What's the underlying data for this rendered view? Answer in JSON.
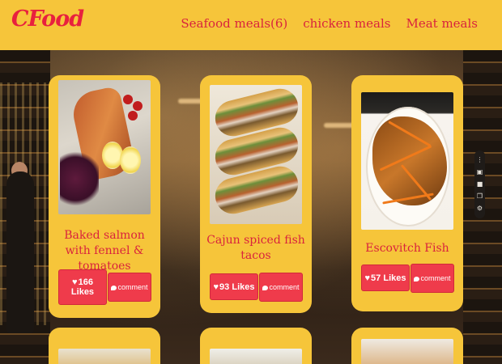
{
  "header": {
    "logo": "CFood",
    "nav": [
      {
        "label": "Seafood meals(6)"
      },
      {
        "label": "chicken meals"
      },
      {
        "label": "Meat meals"
      }
    ]
  },
  "cards": [
    {
      "title": "Baked salmon with fennel & tomatoes",
      "likes_count": "166",
      "likes_word": "Likes",
      "comment_label": "comment"
    },
    {
      "title": "Cajun spiced fish tacos",
      "likes_count": "93",
      "likes_word": "Likes",
      "comment_label": "comment"
    },
    {
      "title": "Escovitch Fish",
      "likes_count": "57",
      "likes_word": "Likes",
      "comment_label": "comment"
    }
  ],
  "colors": {
    "header_bg": "#f6c53a",
    "accent_red": "#d9233d",
    "button_red": "#ef3b4b",
    "card_bg": "#f6c53a"
  },
  "icons": [
    "heart-icon",
    "comment-bubble-icon",
    "camera-icon",
    "video-icon",
    "copy-icon",
    "gear-icon"
  ]
}
